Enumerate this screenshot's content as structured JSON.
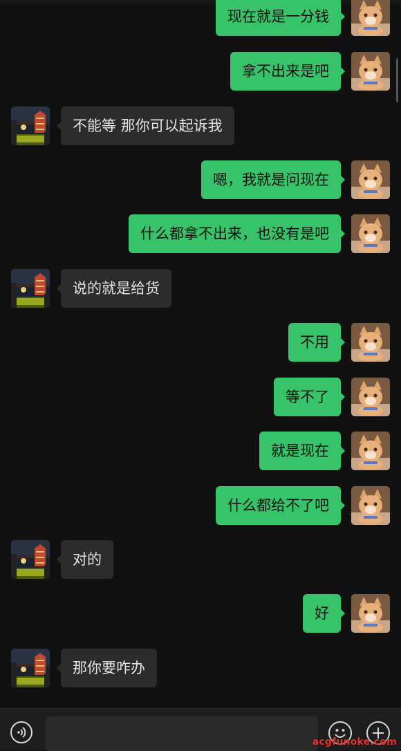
{
  "messages": [
    {
      "side": "me",
      "text": "现在就是一分钱"
    },
    {
      "side": "me",
      "text": "拿不出来是吧"
    },
    {
      "side": "other",
      "text": "不能等 那你可以起诉我"
    },
    {
      "side": "me",
      "text": "嗯，我就是问现在"
    },
    {
      "side": "me",
      "text": "什么都拿不出来，也没有是吧"
    },
    {
      "side": "other",
      "text": "说的就是给货"
    },
    {
      "side": "me",
      "text": "不用"
    },
    {
      "side": "me",
      "text": "等不了"
    },
    {
      "side": "me",
      "text": "就是现在"
    },
    {
      "side": "me",
      "text": "什么都给不了吧"
    },
    {
      "side": "other",
      "text": "对的"
    },
    {
      "side": "me",
      "text": "好"
    },
    {
      "side": "other",
      "text": "那你要咋办"
    }
  ],
  "input_bar": {
    "value": "",
    "voice_icon": "voice-icon",
    "emoji_icon": "emoji-icon",
    "plus_icon": "plus-icon"
  },
  "avatars": {
    "me": "cat-avatar",
    "other": "night-building-avatar"
  },
  "watermark": "acgfunoke.com",
  "colors": {
    "background": "#111111",
    "my_bubble": "#37c36a",
    "their_bubble": "#2c2c2c",
    "input_bar": "#1e1e1e",
    "watermark": "#e8322e"
  }
}
